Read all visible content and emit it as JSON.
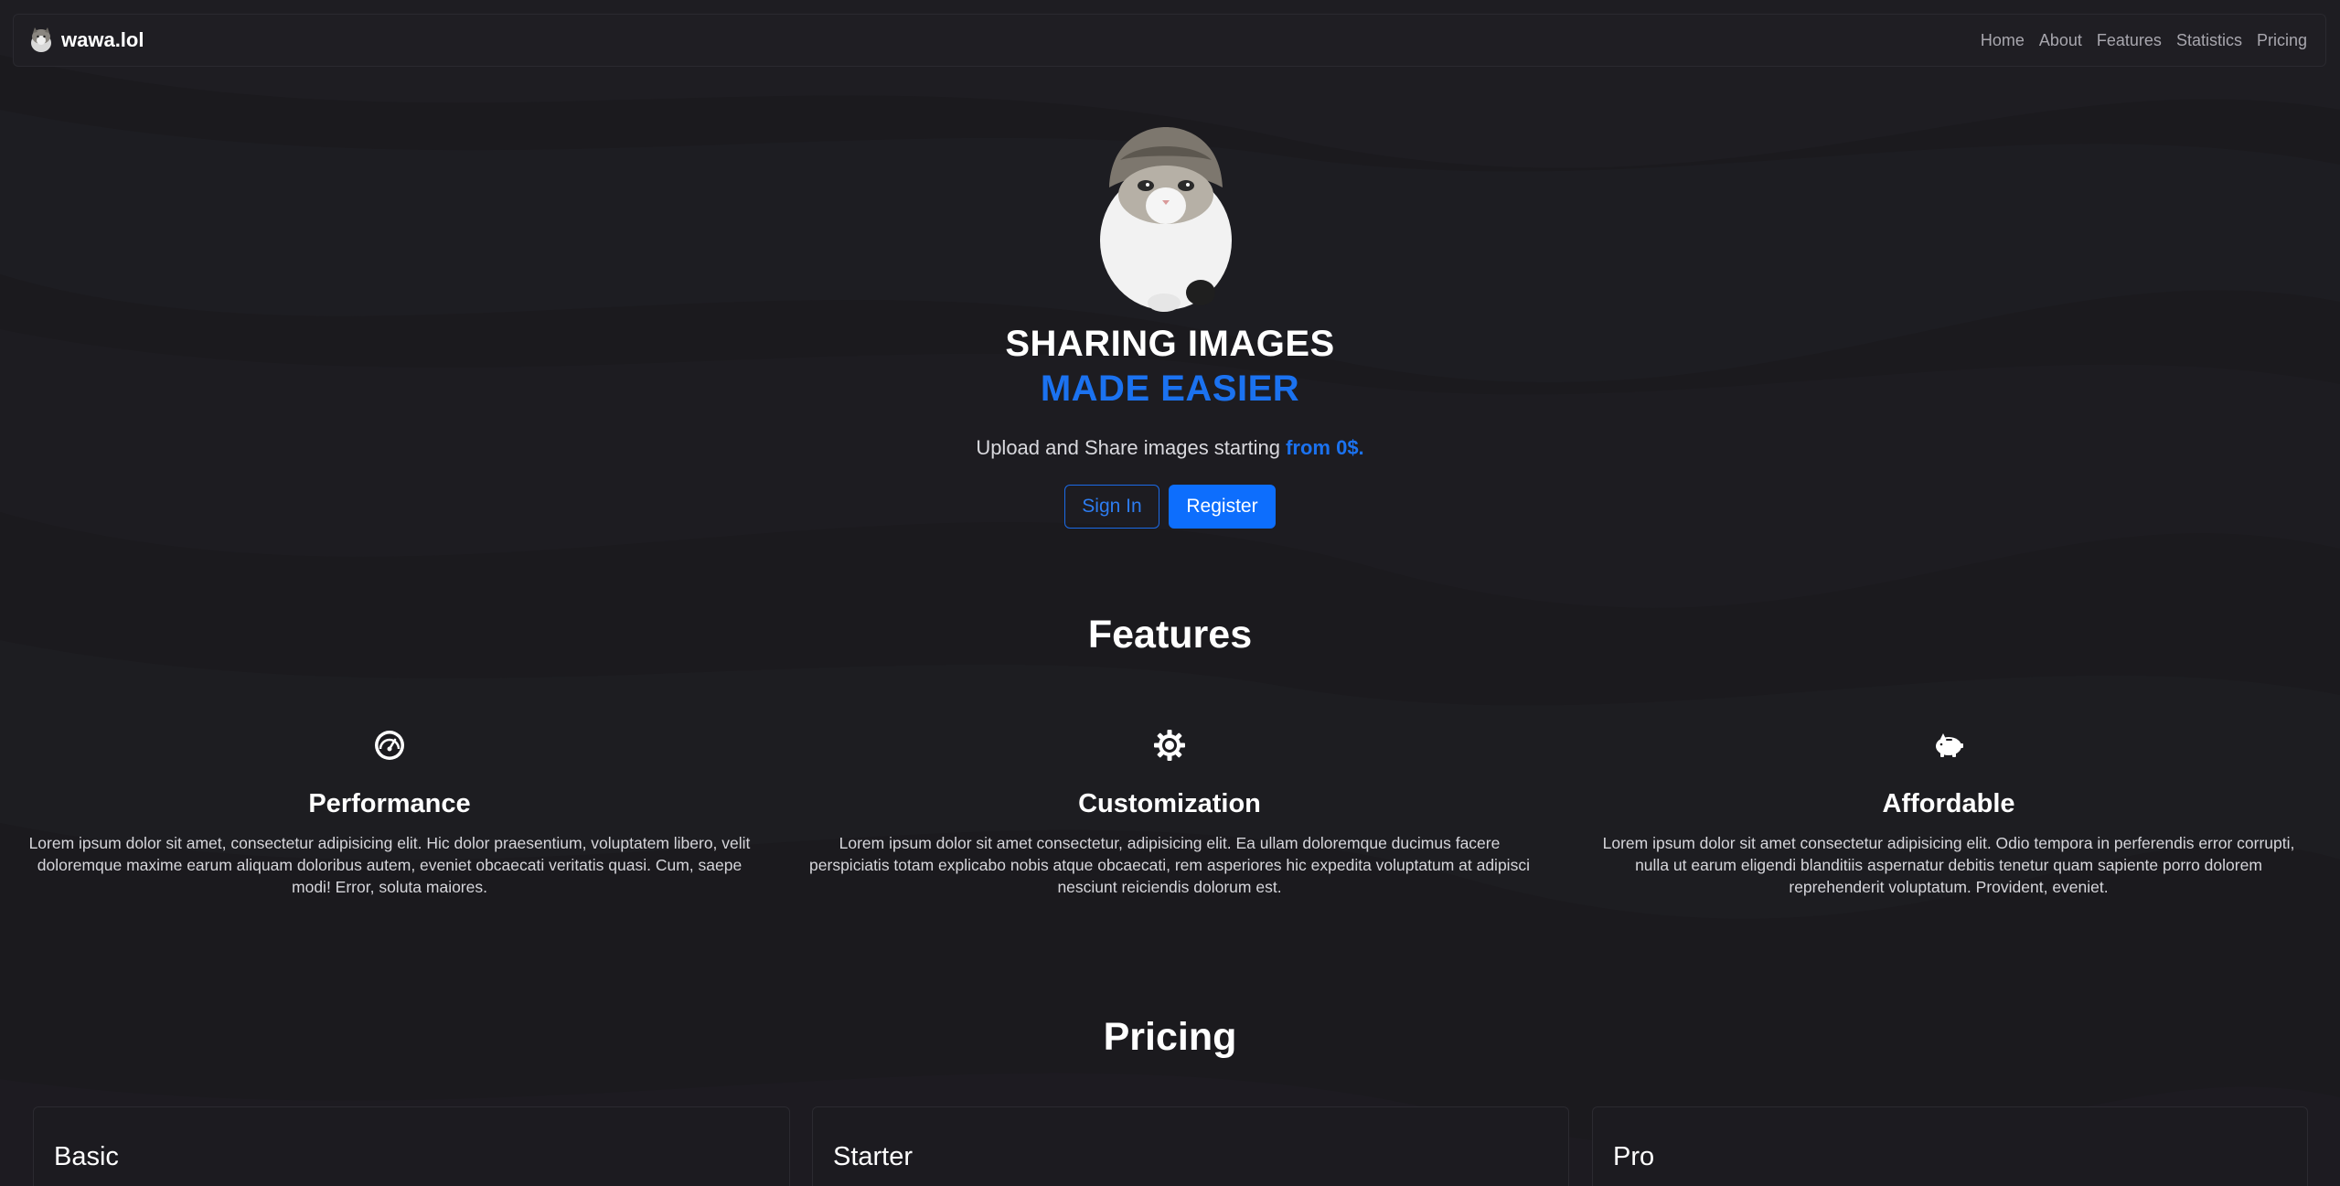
{
  "brand": {
    "name": "wawa.lol"
  },
  "nav": {
    "items": [
      {
        "label": "Home"
      },
      {
        "label": "About"
      },
      {
        "label": "Features"
      },
      {
        "label": "Statistics"
      },
      {
        "label": "Pricing"
      }
    ]
  },
  "hero": {
    "title_line1": "SHARING IMAGES",
    "title_line2": "MADE EASIER",
    "subtitle_prefix": "Upload and Share images starting ",
    "subtitle_highlight": "from 0$.",
    "sign_in_label": "Sign In",
    "register_label": "Register"
  },
  "features": {
    "title": "Features",
    "items": [
      {
        "icon": "speedometer-icon",
        "title": "Performance",
        "text": "Lorem ipsum dolor sit amet, consectetur adipisicing elit. Hic dolor praesentium, voluptatem libero, velit doloremque maxime earum aliquam doloribus autem, eveniet obcaecati veritatis quasi. Cum, saepe modi! Error, soluta maiores."
      },
      {
        "icon": "gear-icon",
        "title": "Customization",
        "text": "Lorem ipsum dolor sit amet consectetur, adipisicing elit. Ea ullam doloremque ducimus facere perspiciatis totam explicabo nobis atque obcaecati, rem asperiores hic expedita voluptatum at adipisci nesciunt reiciendis dolorum est."
      },
      {
        "icon": "piggy-bank-icon",
        "title": "Affordable",
        "text": "Lorem ipsum dolor sit amet consectetur adipisicing elit. Odio tempora in perferendis error corrupti, nulla ut earum eligendi blanditiis aspernatur debitis tenetur quam sapiente porro dolorem reprehenderit voluptatum. Provident, eveniet."
      }
    ]
  },
  "pricing": {
    "title": "Pricing",
    "plans": [
      {
        "name": "Basic"
      },
      {
        "name": "Starter"
      },
      {
        "name": "Pro"
      }
    ]
  },
  "colors": {
    "background": "#1b1a1e",
    "accent": "#0d6efd",
    "highlight_text": "#1b72f0"
  }
}
